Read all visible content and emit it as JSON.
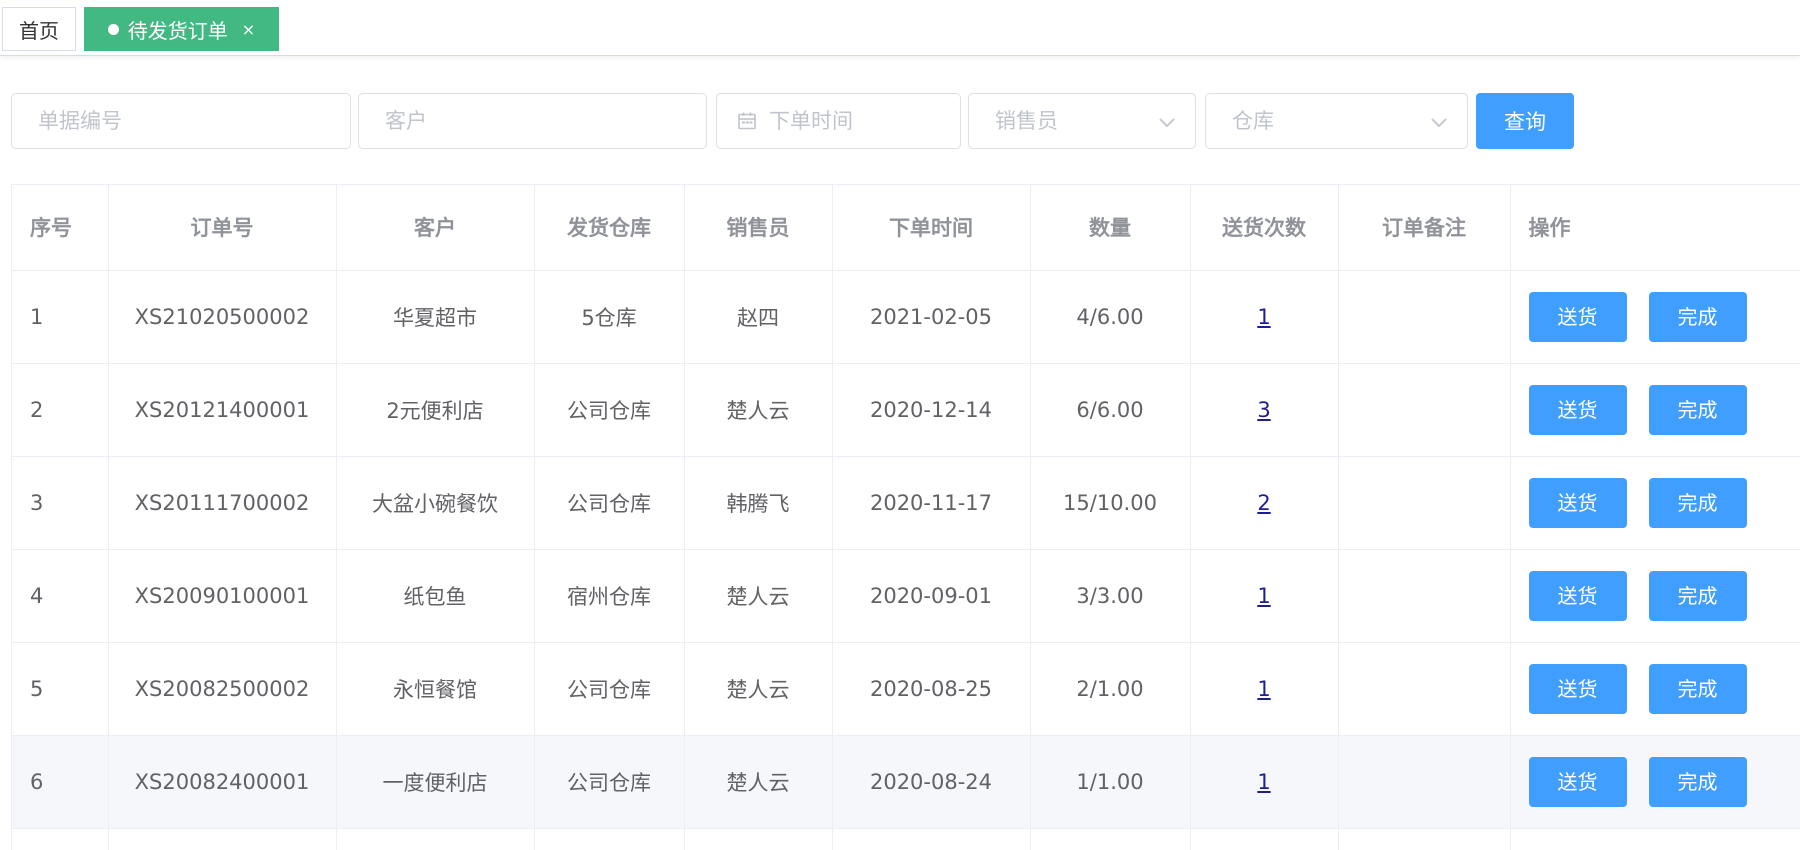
{
  "tabs": {
    "home_label": "首页",
    "active_label": "待发货订单",
    "close_glyph": "×"
  },
  "filters": {
    "order_no_placeholder": "单据编号",
    "customer_placeholder": "客户",
    "date_placeholder": "下单时间",
    "salesman_placeholder": "销售员",
    "warehouse_placeholder": "仓库",
    "query_label": "查询"
  },
  "table": {
    "columns": [
      "序号",
      "订单号",
      "客户",
      "发货仓库",
      "销售员",
      "下单时间",
      "数量",
      "送货次数",
      "订单备注",
      "操作"
    ],
    "deliver_label": "送货",
    "complete_label": "完成",
    "rows": [
      {
        "index": "1",
        "order_no": "XS21020500002",
        "customer": "华夏超市",
        "warehouse": "5仓库",
        "salesman": "赵四",
        "date": "2021-02-05",
        "qty": "4/6.00",
        "deliveries": "1",
        "remark": ""
      },
      {
        "index": "2",
        "order_no": "XS20121400001",
        "customer": "2元便利店",
        "warehouse": "公司仓库",
        "salesman": "楚人云",
        "date": "2020-12-14",
        "qty": "6/6.00",
        "deliveries": "3",
        "remark": ""
      },
      {
        "index": "3",
        "order_no": "XS20111700002",
        "customer": "大盆小碗餐饮",
        "warehouse": "公司仓库",
        "salesman": "韩腾飞",
        "date": "2020-11-17",
        "qty": "15/10.00",
        "deliveries": "2",
        "remark": ""
      },
      {
        "index": "4",
        "order_no": "XS20090100001",
        "customer": "纸包鱼",
        "warehouse": "宿州仓库",
        "salesman": "楚人云",
        "date": "2020-09-01",
        "qty": "3/3.00",
        "deliveries": "1",
        "remark": ""
      },
      {
        "index": "5",
        "order_no": "XS20082500002",
        "customer": "永恒餐馆",
        "warehouse": "公司仓库",
        "salesman": "楚人云",
        "date": "2020-08-25",
        "qty": "2/1.00",
        "deliveries": "1",
        "remark": ""
      },
      {
        "index": "6",
        "order_no": "XS20082400001",
        "customer": "一度便利店",
        "warehouse": "公司仓库",
        "salesman": "楚人云",
        "date": "2020-08-24",
        "qty": "1/1.00",
        "deliveries": "1",
        "remark": ""
      }
    ],
    "highlighted_row": 6
  },
  "colors": {
    "tab_active": "#42b983",
    "primary": "#409eff",
    "link": "#1e1e8f"
  }
}
